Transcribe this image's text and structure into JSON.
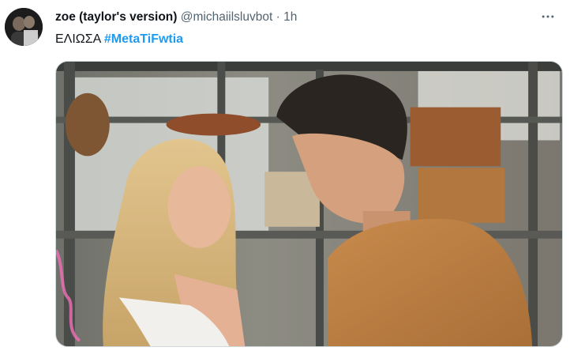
{
  "tweet": {
    "display_name": "zoe (taylor's version)",
    "handle": "@michaiilsluvbot",
    "separator": "·",
    "time": "1h",
    "text": "ΕΛΙΩΣΑ",
    "hashtag": "#MetaTiFwtia",
    "more_icon": "more-horizontal-icon",
    "avatar_icon": "user-avatar"
  },
  "colors": {
    "link": "#1d9bf0",
    "secondary_text": "#536471",
    "primary_text": "#0f1419",
    "border": "#cfd9de"
  }
}
